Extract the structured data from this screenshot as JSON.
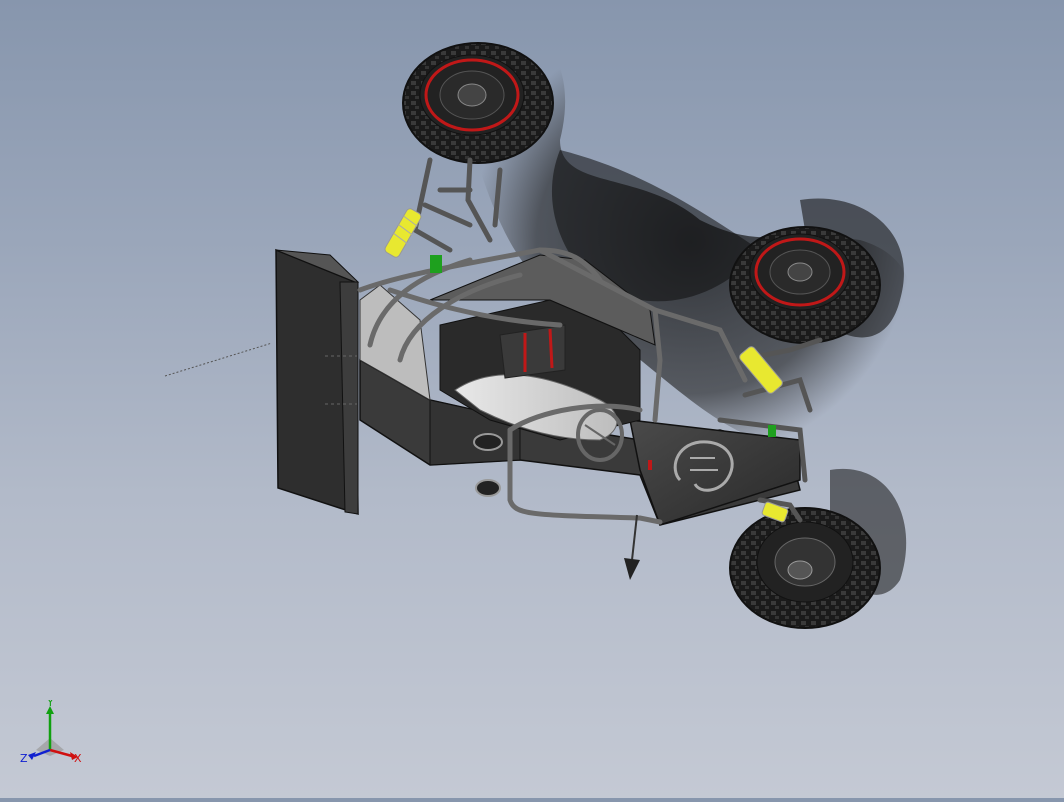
{
  "viewport": {
    "background_top": "#8796ad",
    "background_bottom": "#c4c9d4",
    "model_name": ""
  },
  "triad": {
    "x_label": "X",
    "y_label": "Y",
    "z_label": "Z",
    "x_color": "#d01010",
    "y_color": "#10a010",
    "z_color": "#1020d0"
  },
  "model": {
    "body_color": "#3a3a3a",
    "tire_color": "#1e1e1e",
    "spring_color": "#e8e830",
    "accent_color": "#c01818",
    "hub_color": "#2a2a2a",
    "emblem_icon": "omega-emblem-icon"
  }
}
